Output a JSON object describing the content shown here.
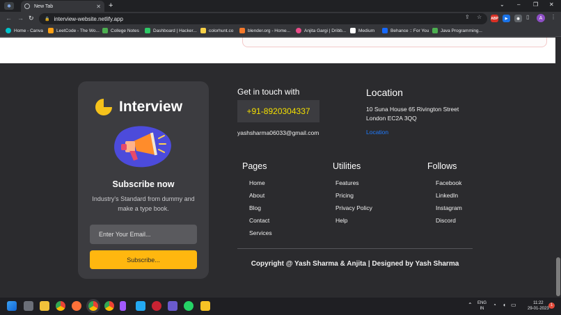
{
  "browser": {
    "tab_title": "New Tab",
    "tab_close": "✕",
    "new_tab": "+",
    "url": "interview-website.netlify.app",
    "window_controls": [
      "⌄",
      "–",
      "❐",
      "✕"
    ],
    "bookmarks": [
      {
        "label": "Home - Canva",
        "color": "#00c4cc"
      },
      {
        "label": "LeetCode - The Wo...",
        "color": "#ffa116"
      },
      {
        "label": "College Notes",
        "color": "#4caf50"
      },
      {
        "label": "Dashboard | Hacker...",
        "color": "#2ec866"
      },
      {
        "label": "colorhunt.co",
        "color": "#f7d046"
      },
      {
        "label": "blender.org - Home...",
        "color": "#f5792a"
      },
      {
        "label": "Anjita Gargi | Dribb...",
        "color": "#ea4c89"
      },
      {
        "label": "Medium",
        "color": "#ffffff"
      },
      {
        "label": "Behance :: For You",
        "color": "#1769ff"
      },
      {
        "label": "Java Programming...",
        "color": "#4caf50"
      }
    ],
    "profile_initial": "A"
  },
  "subscribe": {
    "brand": "Interview",
    "title": "Subscribe now",
    "description": "Industry's Standard from dummy and make a type book.",
    "email_placeholder": "Enter Your Email...",
    "button_label": "Subscribe..."
  },
  "contact": {
    "title": "Get in touch with",
    "phone": "+91-8920304337",
    "email": "yashsharma06033@gmail.com"
  },
  "location": {
    "title": "Location",
    "address_line1": "10 Suna House 65 Rivington Street",
    "address_line2": "London EC2A 3QQ",
    "link": "Location"
  },
  "columns": [
    {
      "title": "Pages",
      "links": [
        "Home",
        "About",
        "Blog",
        "Contact",
        "Services"
      ]
    },
    {
      "title": "Utilities",
      "links": [
        "Features",
        "Pricing",
        "Privacy Policy",
        "Help"
      ]
    },
    {
      "title": "Follows",
      "links": [
        "Facebook",
        "LinkedIn",
        "Instagram",
        "Discord"
      ]
    }
  ],
  "copyright": "Copyright @ Yash Sharma & Anjita | Designed by Yash Sharma",
  "taskbar": {
    "lang": "ENG",
    "region": "IN",
    "time": "11:22",
    "date": "29-01-2023",
    "notification_count": "1"
  },
  "colors": {
    "accent_yellow": "#ffb70f",
    "phone_yellow": "#f5e000",
    "link_blue": "#1f7bff",
    "footer_bg": "#2b2b2e"
  }
}
